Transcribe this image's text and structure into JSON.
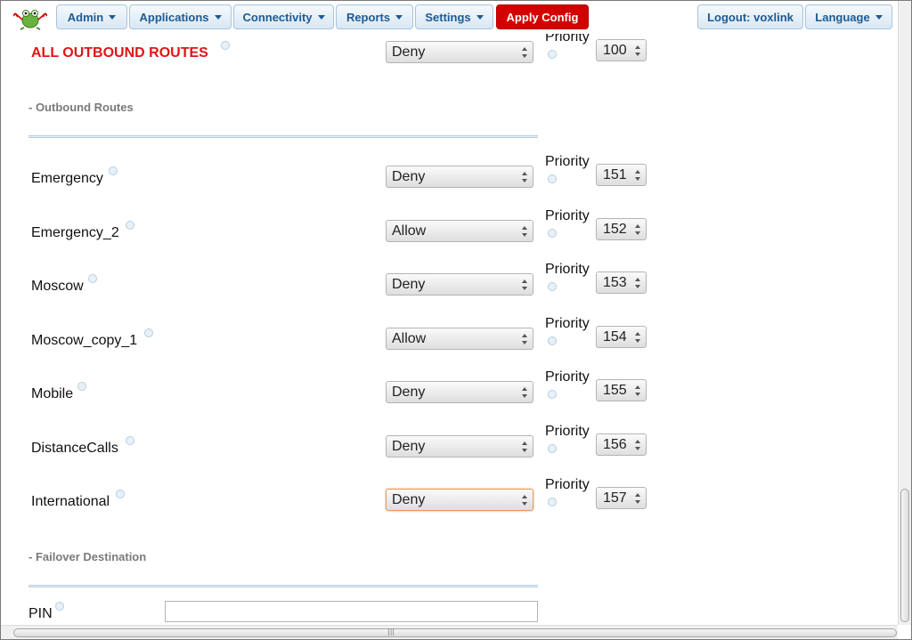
{
  "nav": {
    "items": [
      {
        "label": "Admin"
      },
      {
        "label": "Applications"
      },
      {
        "label": "Connectivity"
      },
      {
        "label": "Reports"
      },
      {
        "label": "Settings"
      }
    ],
    "apply_label": "Apply Config",
    "logout_label": "Logout: voxlink",
    "language_label": "Language"
  },
  "all_routes": {
    "label": "ALL OUTBOUND ROUTES",
    "value": "Deny",
    "priority_label": "Priority",
    "priority": "100"
  },
  "sections": {
    "outbound_routes": "- Outbound Routes",
    "failover": "- Failover Destination"
  },
  "routes": [
    {
      "name": "Emergency",
      "value": "Deny",
      "priority_label": "Priority",
      "priority": "151"
    },
    {
      "name": "Emergency_2",
      "value": "Allow",
      "priority_label": "Priority",
      "priority": "152"
    },
    {
      "name": "Moscow",
      "value": "Deny",
      "priority_label": "Priority",
      "priority": "153"
    },
    {
      "name": "Moscow_copy_1",
      "value": "Allow",
      "priority_label": "Priority",
      "priority": "154"
    },
    {
      "name": "Mobile",
      "value": "Deny",
      "priority_label": "Priority",
      "priority": "155"
    },
    {
      "name": "DistanceCalls",
      "value": "Deny",
      "priority_label": "Priority",
      "priority": "156"
    },
    {
      "name": "International",
      "value": "Deny",
      "priority_label": "Priority",
      "priority": "157"
    }
  ],
  "pin": {
    "label": "PIN",
    "value": ""
  },
  "colors": {
    "accent": "#1d5a93",
    "apply_button": "#d30000",
    "all_routes_title": "#e01515"
  },
  "icons": {
    "logo": "frog-logo-icon",
    "help": "help-icon",
    "dropdown": "chevron-down-icon"
  }
}
